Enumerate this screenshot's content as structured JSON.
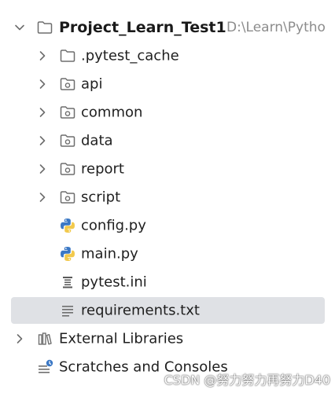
{
  "project": {
    "root_name": "Project_Learn_Test1",
    "root_path": "D:\\Learn\\Pytho",
    "items": [
      {
        "label": ".pytest_cache",
        "icon": "folder-icon"
      },
      {
        "label": "api",
        "icon": "package-folder-icon"
      },
      {
        "label": "common",
        "icon": "package-folder-icon"
      },
      {
        "label": "data",
        "icon": "package-folder-icon"
      },
      {
        "label": "report",
        "icon": "package-folder-icon"
      },
      {
        "label": "script",
        "icon": "package-folder-icon"
      },
      {
        "label": "config.py",
        "icon": "python-file-icon"
      },
      {
        "label": "main.py",
        "icon": "python-file-icon"
      },
      {
        "label": "pytest.ini",
        "icon": "ini-file-icon"
      },
      {
        "label": "requirements.txt",
        "icon": "text-file-icon",
        "selected": true
      }
    ]
  },
  "external_libraries": {
    "label": "External Libraries",
    "icon": "library-icon"
  },
  "scratches": {
    "label": "Scratches and Consoles",
    "icon": "scratches-icon"
  },
  "watermark": "CSDN @努力努力再努力D40",
  "colors": {
    "selection": "#dfe1e5",
    "icon_gray": "#6e6e6e",
    "python_blue": "#3b78c5",
    "python_yellow": "#f2c94c",
    "path_gray": "#8c8c8c"
  }
}
